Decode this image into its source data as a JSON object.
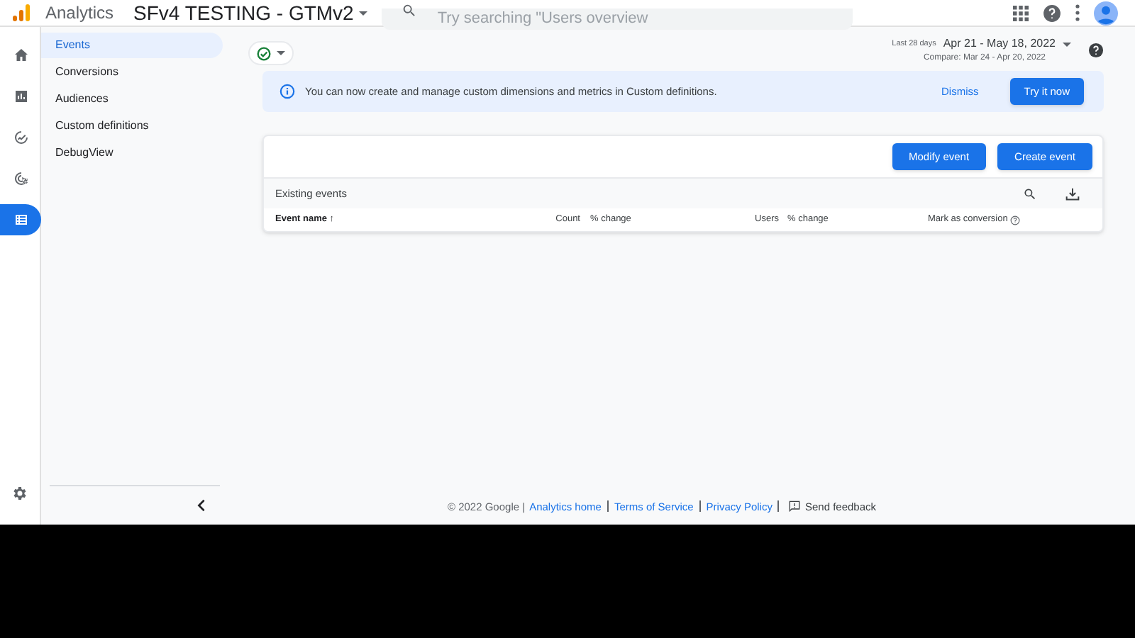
{
  "header": {
    "app_name": "Analytics",
    "property": "SFv4 TESTING - GTMv2",
    "search": {
      "placeholder": "Try searching \"Users overview"
    }
  },
  "rail": {
    "items": [
      {
        "kind": "home",
        "selected": false
      },
      {
        "kind": "reports",
        "selected": false
      },
      {
        "kind": "explore",
        "selected": false
      },
      {
        "kind": "advertising",
        "selected": false
      },
      {
        "kind": "configure",
        "selected": true
      }
    ]
  },
  "nav": {
    "items": [
      {
        "label": "Events",
        "selected": true
      },
      {
        "label": "Conversions",
        "selected": false
      },
      {
        "label": "Audiences",
        "selected": false
      },
      {
        "label": "Custom definitions",
        "selected": false
      },
      {
        "label": "DebugView",
        "selected": false
      }
    ]
  },
  "date_range": {
    "label": "Last 28 days",
    "range": "Apr 21 - May 18, 2022",
    "compare": "Compare: Mar 24 - Apr 20, 2022"
  },
  "banner": {
    "text": "You can now create and manage custom dimensions and metrics in Custom definitions.",
    "dismiss": "Dismiss",
    "action": "Try it now"
  },
  "buttons": [
    "Modify event",
    "Create event"
  ],
  "table": {
    "title": "Existing events",
    "columns": [
      {
        "label": "Event name ↑",
        "bold": true
      },
      {
        "label": "Count",
        "bold": false
      },
      {
        "label": "% change",
        "bold": false
      },
      {
        "label": "Users",
        "bold": false
      },
      {
        "label": "% change",
        "bold": false
      },
      {
        "label": "Mark as conversion",
        "bold": false
      }
    ]
  },
  "footer": {
    "copyright": "© 2022 Google |",
    "links": [
      "Analytics home",
      "Terms of Service",
      "Privacy Policy"
    ],
    "feedback": "Send feedback"
  }
}
